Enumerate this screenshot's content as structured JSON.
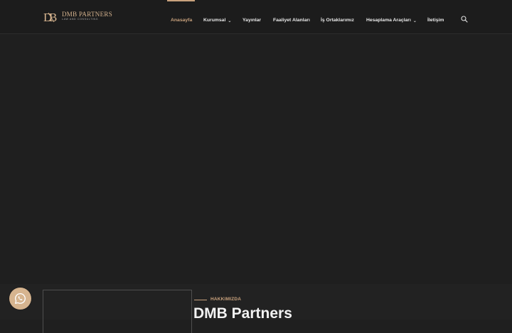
{
  "brand": {
    "monogram": "DMB",
    "name": "DMB PARTNERS",
    "tagline": "LAW AND CONSULTING"
  },
  "nav": {
    "items": [
      {
        "label": "Anasayfa",
        "active": true
      },
      {
        "label": "Kurumsal",
        "dropdown": true
      },
      {
        "label": "Yayınlar"
      },
      {
        "label": "Faaliyet Alanları"
      },
      {
        "label": "İş Ortaklarımız"
      },
      {
        "label": "Hesaplama Araçları",
        "dropdown": true
      },
      {
        "label": "İletişim"
      }
    ],
    "search_icon": "search-icon"
  },
  "about": {
    "label": "HAKKIMIZDA",
    "title": "DMB Partners"
  },
  "whatsapp": {
    "icon": "whatsapp-icon"
  },
  "colors": {
    "accent": "#c9a27d",
    "header_bg": "#1c1c1c",
    "page_bg": "#1f1f1f",
    "whatsapp_button": "#d6b48f"
  }
}
